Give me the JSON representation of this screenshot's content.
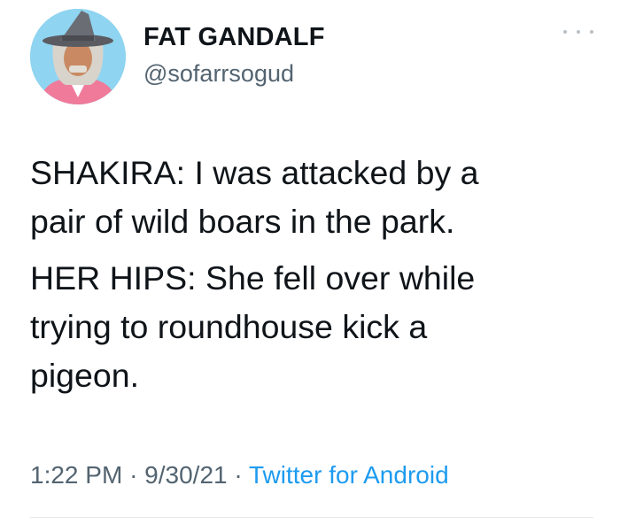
{
  "author": {
    "display_name": "FAT GANDALF",
    "handle": "@sofarrsogud"
  },
  "tweet": {
    "paragraphs": [
      "SHAKIRA: I was attacked by a\npair of wild boars in the park.",
      "HER HIPS: She fell over while\ntrying to roundhouse kick a\npigeon."
    ],
    "time": "1:22 PM",
    "date": "9/30/21",
    "separator": "·",
    "source": "Twitter for Android"
  },
  "icons": {
    "more": "more-options-icon"
  },
  "colors": {
    "text": "#0f1419",
    "secondary": "#536471",
    "link": "#1d9bf0"
  }
}
